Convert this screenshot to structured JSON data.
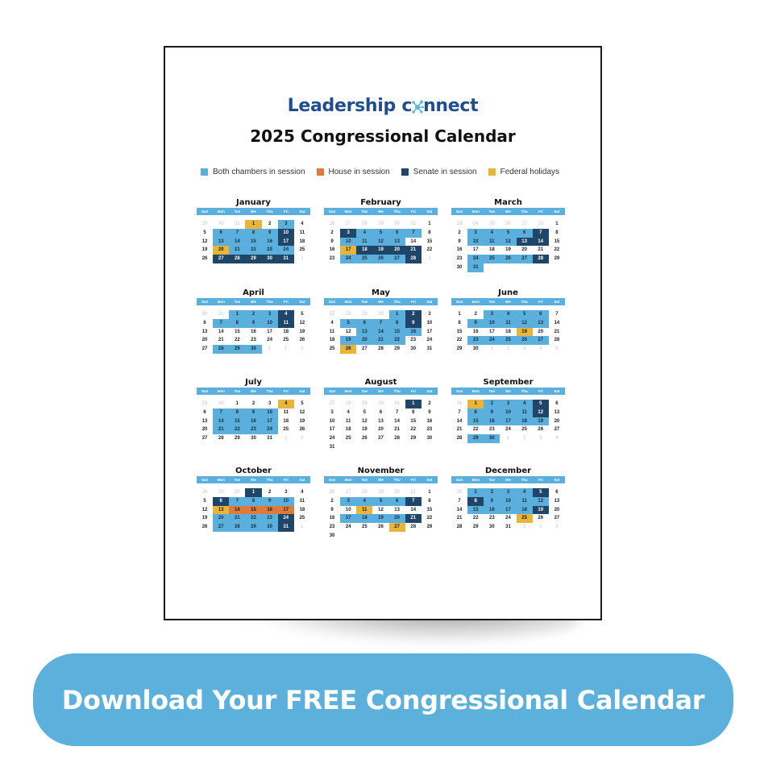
{
  "document": {
    "logo_text_before": "Leadership c",
    "logo_text_after": "nnect",
    "logo_icon": "network-node-icon",
    "title": "2025 Congressional Calendar",
    "legend": [
      {
        "label": "Both chambers in session",
        "key": "both",
        "color": "#5aafdc"
      },
      {
        "label": "House in session",
        "key": "house",
        "color": "#e07a3a"
      },
      {
        "label": "Senate in session",
        "key": "senate",
        "color": "#1f4568"
      },
      {
        "label": "Federal holidays",
        "key": "holiday",
        "color": "#e9b43a"
      }
    ],
    "weekdays": [
      "Sun",
      "Mon",
      "Tue",
      "We",
      "Thu",
      "Fri",
      "Sat"
    ],
    "months": [
      {
        "name": "January",
        "prev_days": [
          29,
          30,
          31
        ],
        "days_in_month": 31,
        "next_days": [
          1
        ],
        "both": [
          3,
          6,
          7,
          8,
          9,
          13,
          14,
          15,
          16,
          21,
          22,
          23,
          24
        ],
        "senate": [
          10,
          17,
          27,
          28,
          29,
          30,
          31
        ],
        "house": [],
        "holiday": [
          1,
          20
        ]
      },
      {
        "name": "February",
        "prev_days": [
          26,
          27,
          28,
          29,
          30,
          31
        ],
        "days_in_month": 28,
        "next_days": [
          1
        ],
        "both": [
          4,
          5,
          6,
          7,
          10,
          11,
          12,
          13,
          24,
          25,
          26,
          27
        ],
        "senate": [
          3,
          18,
          19,
          20,
          21,
          28
        ],
        "house": [],
        "holiday": [
          17
        ]
      },
      {
        "name": "March",
        "prev_days": [
          23,
          24,
          25,
          26,
          27,
          28
        ],
        "days_in_month": 31,
        "next_days": [],
        "both": [
          3,
          4,
          5,
          6,
          10,
          11,
          12,
          24,
          25,
          26,
          27,
          31
        ],
        "senate": [
          7,
          13,
          14,
          28
        ],
        "house": [],
        "holiday": []
      },
      {
        "name": "April",
        "prev_days": [
          30,
          31
        ],
        "days_in_month": 30,
        "next_days": [
          1,
          2,
          3
        ],
        "both": [
          1,
          2,
          3,
          7,
          8,
          9,
          10,
          28,
          29,
          30
        ],
        "senate": [
          4,
          11
        ],
        "house": [],
        "holiday": []
      },
      {
        "name": "May",
        "prev_days": [
          27,
          28,
          29,
          30
        ],
        "days_in_month": 31,
        "next_days": [],
        "both": [
          1,
          5,
          6,
          7,
          8,
          13,
          14,
          15,
          16,
          19,
          20,
          21,
          22
        ],
        "senate": [
          2,
          9
        ],
        "house": [],
        "holiday": [
          26
        ]
      },
      {
        "name": "June",
        "prev_days": [],
        "days_in_month": 30,
        "next_days": [
          1,
          2,
          3,
          4,
          5
        ],
        "both": [
          3,
          4,
          5,
          6,
          9,
          10,
          11,
          12,
          13,
          23,
          24,
          25,
          26,
          27
        ],
        "senate": [],
        "house": [],
        "holiday": [
          19
        ]
      },
      {
        "name": "July",
        "prev_days": [
          29,
          30
        ],
        "days_in_month": 31,
        "next_days": [
          1,
          2
        ],
        "both": [
          7,
          8,
          9,
          10,
          14,
          15,
          16,
          17,
          21,
          22,
          23,
          24
        ],
        "senate": [],
        "house": [],
        "holiday": [
          4
        ]
      },
      {
        "name": "August",
        "prev_days": [
          27,
          28,
          29,
          30,
          31
        ],
        "days_in_month": 31,
        "next_days": [],
        "both": [],
        "senate": [
          1
        ],
        "house": [],
        "holiday": []
      },
      {
        "name": "September",
        "prev_days": [
          31
        ],
        "days_in_month": 30,
        "next_days": [
          1,
          2,
          3,
          4
        ],
        "both": [
          2,
          3,
          4,
          8,
          9,
          10,
          11,
          15,
          16,
          17,
          18,
          19,
          29,
          30
        ],
        "senate": [
          5,
          12
        ],
        "house": [],
        "holiday": [
          1
        ]
      },
      {
        "name": "October",
        "prev_days": [
          28,
          29,
          30
        ],
        "days_in_month": 31,
        "next_days": [
          1
        ],
        "both": [
          7,
          8,
          9,
          10,
          20,
          21,
          22,
          23,
          27,
          28,
          29,
          30
        ],
        "senate": [
          1,
          6,
          24,
          31
        ],
        "house": [
          14,
          15,
          16,
          17
        ],
        "holiday": [
          13
        ]
      },
      {
        "name": "November",
        "prev_days": [
          26,
          27,
          28,
          29,
          30,
          31
        ],
        "days_in_month": 30,
        "next_days": [],
        "both": [
          3,
          4,
          5,
          6,
          17,
          18,
          19,
          20
        ],
        "senate": [
          7,
          21
        ],
        "house": [],
        "holiday": [
          11,
          27
        ]
      },
      {
        "name": "December",
        "prev_days": [
          30
        ],
        "days_in_month": 31,
        "next_days": [
          1,
          2,
          3
        ],
        "both": [
          1,
          2,
          3,
          4,
          9,
          10,
          11,
          12,
          15,
          16,
          17,
          18
        ],
        "senate": [
          5,
          8,
          19
        ],
        "house": [],
        "holiday": [
          25
        ]
      }
    ]
  },
  "cta": {
    "label": "Download Your FREE Congressional Calendar",
    "color": "#5cb0dc"
  }
}
